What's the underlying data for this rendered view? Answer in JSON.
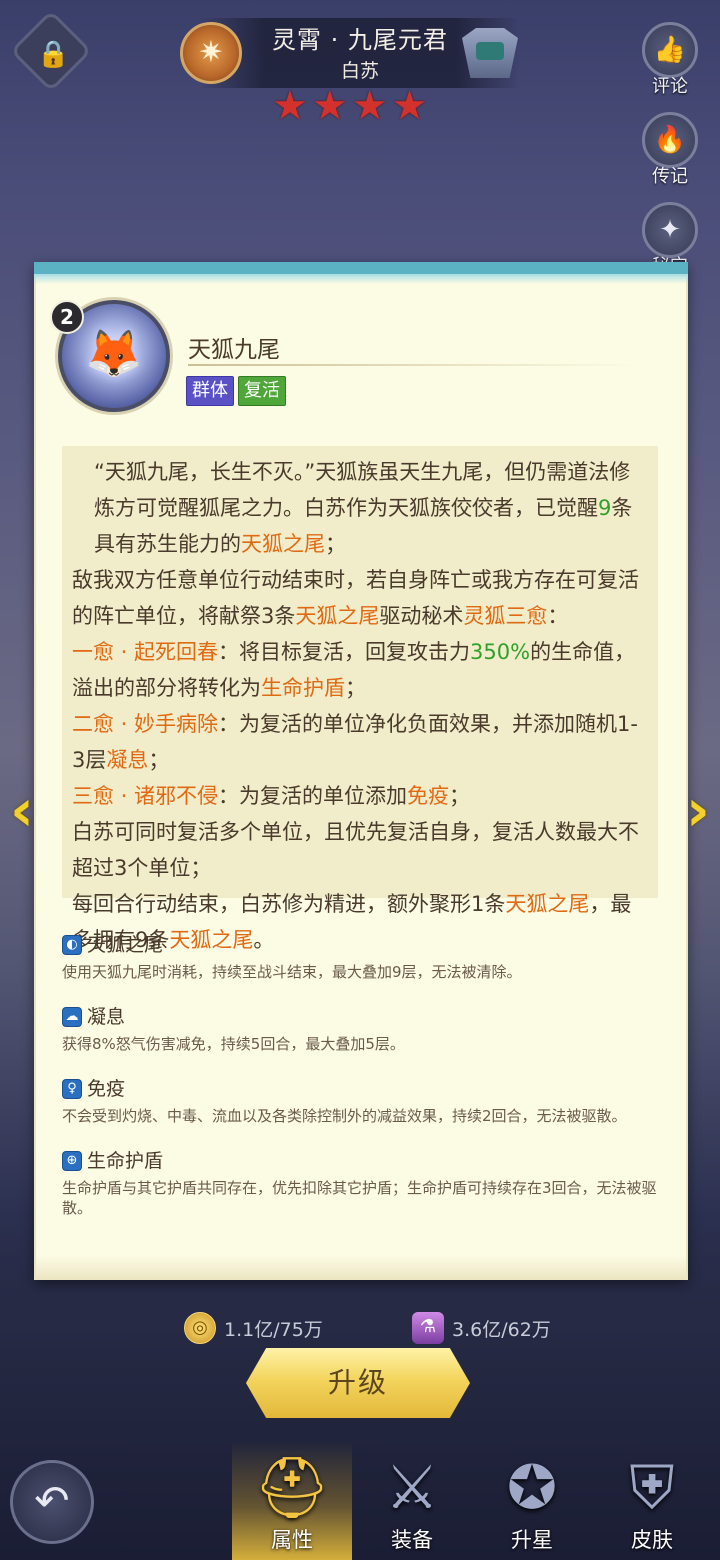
{
  "hero": {
    "title": "灵霄 · 九尾元君",
    "name": "白苏",
    "star_count": 4
  },
  "side_buttons": [
    {
      "label": "评论",
      "icon": "thumbs-up-card-icon"
    },
    {
      "label": "传记",
      "icon": "book-fire-icon"
    },
    {
      "label": "秘宝",
      "icon": "compass-star-icon"
    }
  ],
  "skill": {
    "level": "2",
    "name": "天狐九尾",
    "tags": [
      "群体",
      "复活"
    ],
    "description": {
      "p1_a": "“天狐九尾，长生不灭。”天狐族虽天生九尾，但仍需道法修炼方可觉醒狐尾之力。白苏作为天狐族佼佼者，已觉醒",
      "p1_num": "9",
      "p1_b": "条具有苏生能力的",
      "p1_key": "天狐之尾",
      "p1_c": "；",
      "p2_a": "敌我双方任意单位行动结束时，若自身阵亡或我方存在可复活的阵亡单位，将献祭3条",
      "p2_key": "天狐之尾",
      "p2_b": "驱动秘术",
      "p2_key2": "灵狐三愈",
      "p2_c": "：",
      "p3_key": "一愈 · 起死回春",
      "p3_a": "：将目标复活，回复攻击力",
      "p3_num": "350%",
      "p3_b": "的生命值，溢出的部分将转化为",
      "p3_key2": "生命护盾",
      "p3_c": "；",
      "p4_key": "二愈 · 妙手病除",
      "p4_a": "：为复活的单位净化负面效果，并添加随机1-3层",
      "p4_key2": "凝息",
      "p4_c": "；",
      "p5_key": "三愈 · 诸邪不侵",
      "p5_a": "：为复活的单位添加",
      "p5_key2": "免疫",
      "p5_c": "；",
      "p6": "白苏可同时复活多个单位，且优先复活自身，复活人数最大不超过3个单位；",
      "p7_a": "每回合行动结束，白苏修为精进，额外聚形1条",
      "p7_key": "天狐之尾",
      "p7_b": "，最多拥有9条",
      "p7_key2": "天狐之尾",
      "p7_c": "。"
    }
  },
  "notes": [
    {
      "title": "天狐之尾",
      "icon": "fox-tail-icon",
      "body": "使用天狐九尾时消耗，持续至战斗结束，最大叠加9层，无法被清除。"
    },
    {
      "title": "凝息",
      "icon": "ghost-breath-icon",
      "body": "获得8%怒气伤害减免，持续5回合，最大叠加5层。"
    },
    {
      "title": "免疫",
      "icon": "immunity-person-icon",
      "body": "不会受到灼烧、中毒、流血以及各类除控制外的减益效果，持续2回合，无法被驱散。"
    },
    {
      "title": "生命护盾",
      "icon": "shield-cross-icon",
      "body": "生命护盾与其它护盾共同存在，优先扣除其它护盾；生命护盾可持续存在3回合，无法被驱散。"
    }
  ],
  "costs": {
    "gold": "1.1亿/75万",
    "exp": "3.6亿/62万"
  },
  "upgrade_label": "升级",
  "nav": [
    {
      "label": "属性",
      "icon": "helmet-icon",
      "active": true
    },
    {
      "label": "装备",
      "icon": "swords-icon",
      "active": false
    },
    {
      "label": "升星",
      "icon": "star-badge-icon",
      "active": false
    },
    {
      "label": "皮肤",
      "icon": "armor-icon",
      "active": false
    }
  ],
  "colors": {
    "keyword": "#e06a14",
    "number": "#2fa12a",
    "tag_group": "#5a52c4",
    "tag_revive": "#4ea738",
    "star": "#d3312c",
    "upgrade": "#f3d45d"
  }
}
